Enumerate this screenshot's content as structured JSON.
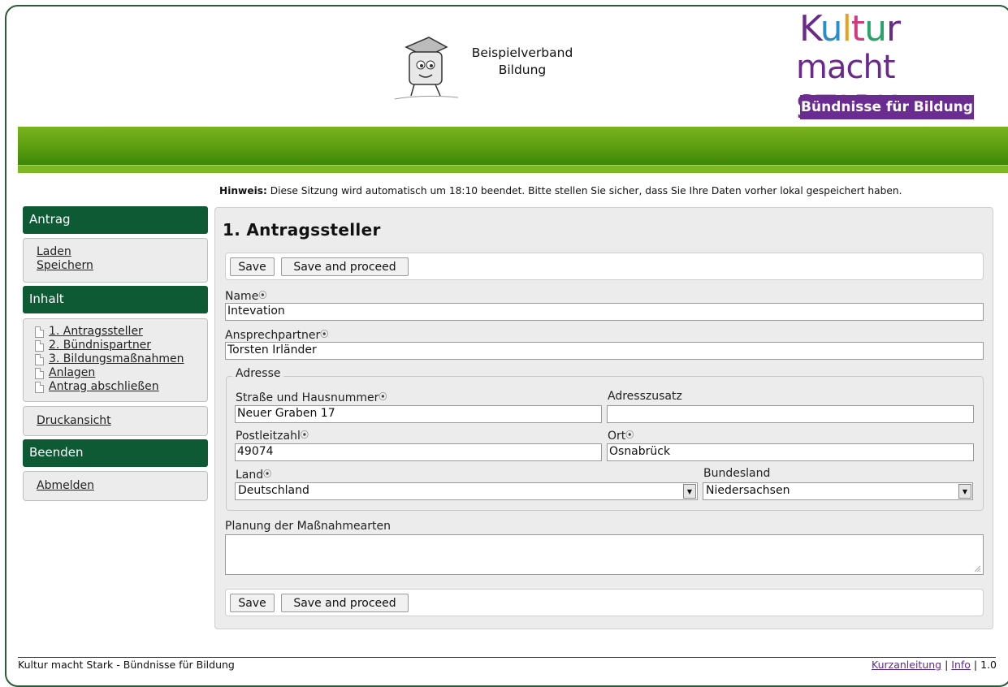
{
  "header": {
    "org_name_line1": "Beispielverband",
    "org_name_line2": "Bildung",
    "brand_word1": "Kultur",
    "brand_word2": "macht STARK",
    "brand_tagline": "Bündnisse für Bildung"
  },
  "notice": {
    "label": "Hinweis:",
    "text": " Diese Sitzung wird automatisch um 18:10 beendet. Bitte stellen Sie sicher, dass Sie Ihre Daten vorher lokal gespeichert haben."
  },
  "sidebar": {
    "antrag_header": "Antrag",
    "antrag_links": [
      "Laden",
      "Speichern"
    ],
    "inhalt_header": "Inhalt",
    "inhalt_items": [
      "1. Antragssteller",
      "2. Bündnispartner",
      "3. Bildungsmaßnahmen",
      "Anlagen",
      "Antrag abschließen"
    ],
    "print_link": "Druckansicht",
    "beenden_header": "Beenden",
    "logout_link": "Abmelden"
  },
  "form": {
    "title": "1. Antragssteller",
    "save_label": "Save",
    "save_proceed_label": "Save and proceed",
    "name_label": "Name",
    "name_value": "Intevation",
    "contact_label": "Ansprechpartner",
    "contact_value": "Torsten Irländer",
    "address_legend": "Adresse",
    "street_label": "Straße und Hausnummer",
    "street_value": "Neuer Graben 17",
    "addon_label": "Adresszusatz",
    "addon_value": "",
    "zip_label": "Postleitzahl",
    "zip_value": "49074",
    "city_label": "Ort",
    "city_value": "Osnabrück",
    "country_label": "Land",
    "country_value": "Deutschland",
    "state_label": "Bundesland",
    "state_value": "Niedersachsen",
    "planning_label": "Planung der Maßnahmearten",
    "required_marker": "⦿"
  },
  "footer": {
    "left": "Kultur macht Stark - Bündnisse für Bildung",
    "link1": "Kurzanleitung",
    "sep": " | ",
    "link2": "Info",
    "version": " | 1.0"
  },
  "colors": {
    "sidebar_header": "#0e5a35",
    "green_bar": "#5c9d10",
    "brand_purple": "#6b2c91"
  }
}
